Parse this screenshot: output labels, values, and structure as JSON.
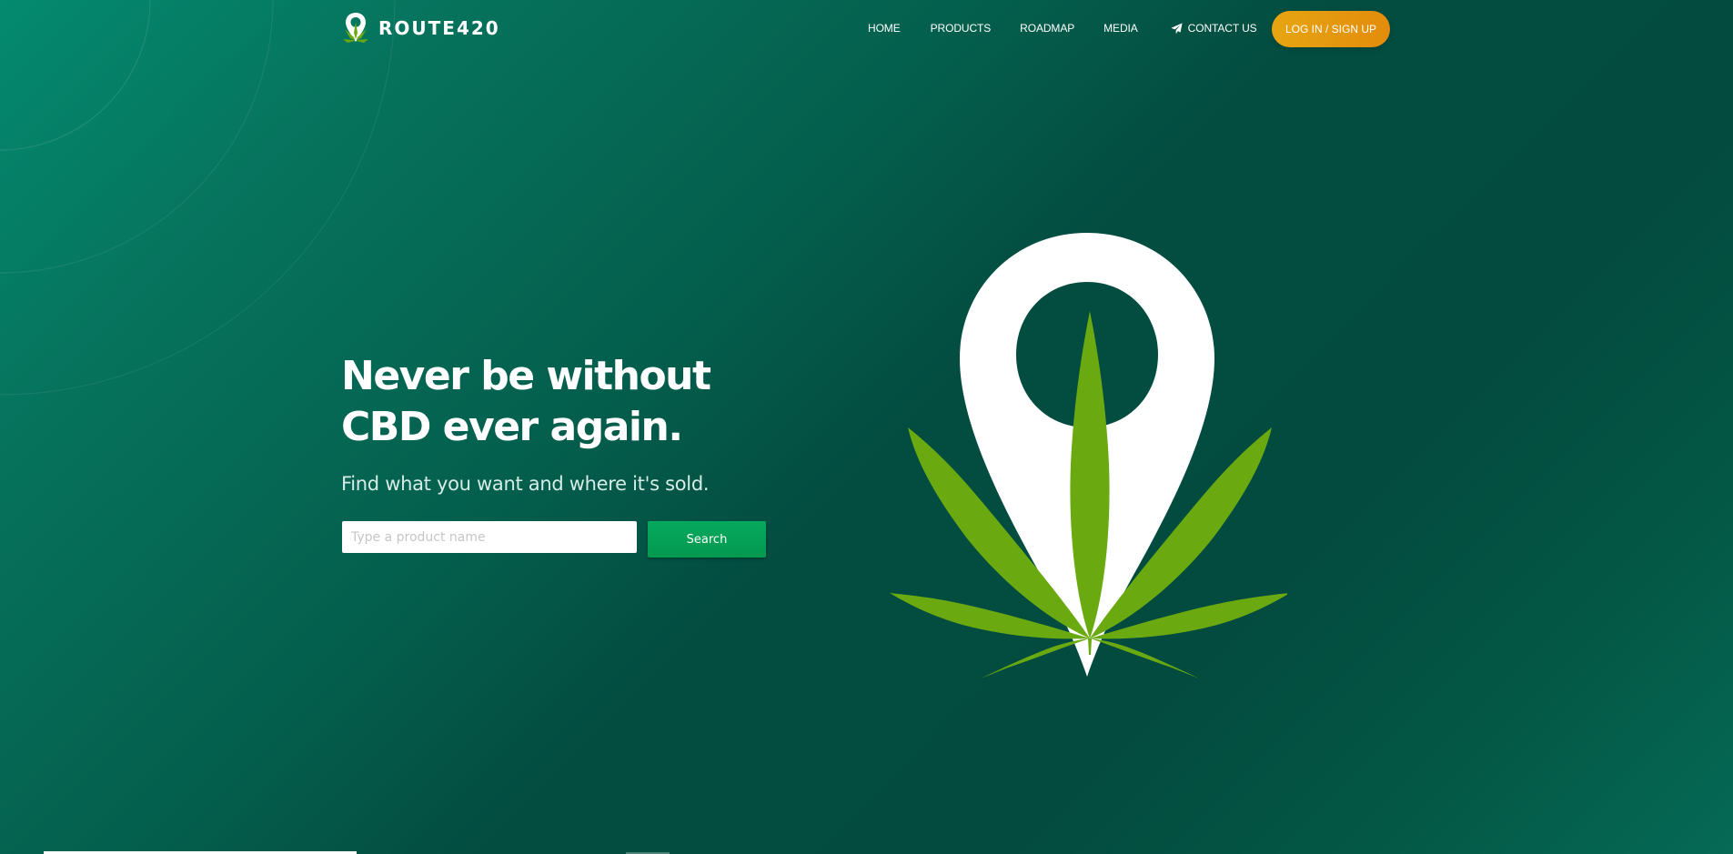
{
  "brand": {
    "name": "ROUTE420",
    "logo_icon": "map-pin-leaf-icon"
  },
  "nav": {
    "items": [
      {
        "label": "HOME"
      },
      {
        "label": "PRODUCTS"
      },
      {
        "label": "ROADMAP"
      },
      {
        "label": "MEDIA"
      },
      {
        "label": "CONTACT US",
        "icon": "paper-plane-icon"
      }
    ],
    "login_label": "LOG IN / SIGN UP"
  },
  "hero": {
    "title_line1": "Never be without",
    "title_line2": "CBD ever again.",
    "subtitle": "Find what you want and where it's sold.",
    "search": {
      "placeholder": "Type a product name",
      "value": "",
      "button_label": "Search"
    },
    "graphic_icon": "map-pin-cannabis-leaf-icon"
  },
  "colors": {
    "background_dark": "#034b3f",
    "background_light": "#048a6f",
    "accent_orange": "#e6a512",
    "search_green": "#03a356",
    "leaf_green": "#6aaa10"
  }
}
